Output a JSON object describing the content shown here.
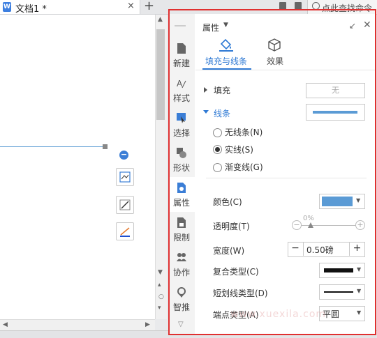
{
  "tabbar": {
    "doc_tab_title": "文档1 *",
    "close_glyph": "×",
    "new_tab_glyph": "+",
    "search_text": "点此查找命令"
  },
  "canvas": {
    "minus_glyph": "−"
  },
  "strip": {
    "items": [
      {
        "label": "新建",
        "icon": "new-doc-icon"
      },
      {
        "label": "样式",
        "icon": "style-icon"
      },
      {
        "label": "选择",
        "icon": "select-icon"
      },
      {
        "label": "形状",
        "icon": "shape-icon"
      },
      {
        "label": "属性",
        "icon": "property-icon",
        "active": true
      },
      {
        "label": "限制",
        "icon": "limit-icon"
      },
      {
        "label": "协作",
        "icon": "collab-icon"
      },
      {
        "label": "智推",
        "icon": "smart-icon"
      }
    ]
  },
  "panel": {
    "title": "属性",
    "tabs": [
      {
        "label": "填充与线条",
        "active": true
      },
      {
        "label": "效果"
      }
    ],
    "fill_section": "填充",
    "fill_value": "无",
    "line_section": "线条",
    "line_options": [
      {
        "label": "无线条(N)",
        "selected": false
      },
      {
        "label": "实线(S)",
        "selected": true
      },
      {
        "label": "渐变线(G)",
        "selected": false
      }
    ],
    "color_label": "颜色(C)",
    "transparency_label": "透明度(T)",
    "transparency_value": "0%",
    "width_label": "宽度(W)",
    "width_value": "0.50磅",
    "compound_label": "复合类型(C)",
    "dash_label": "短划线类型(D)",
    "endpoint_label": "端点类型(A)",
    "endpoint_value": "平圆",
    "accent_color": "#2e79d4",
    "line_color": "#5b9bd5"
  },
  "watermark": "www.xuexila.com"
}
